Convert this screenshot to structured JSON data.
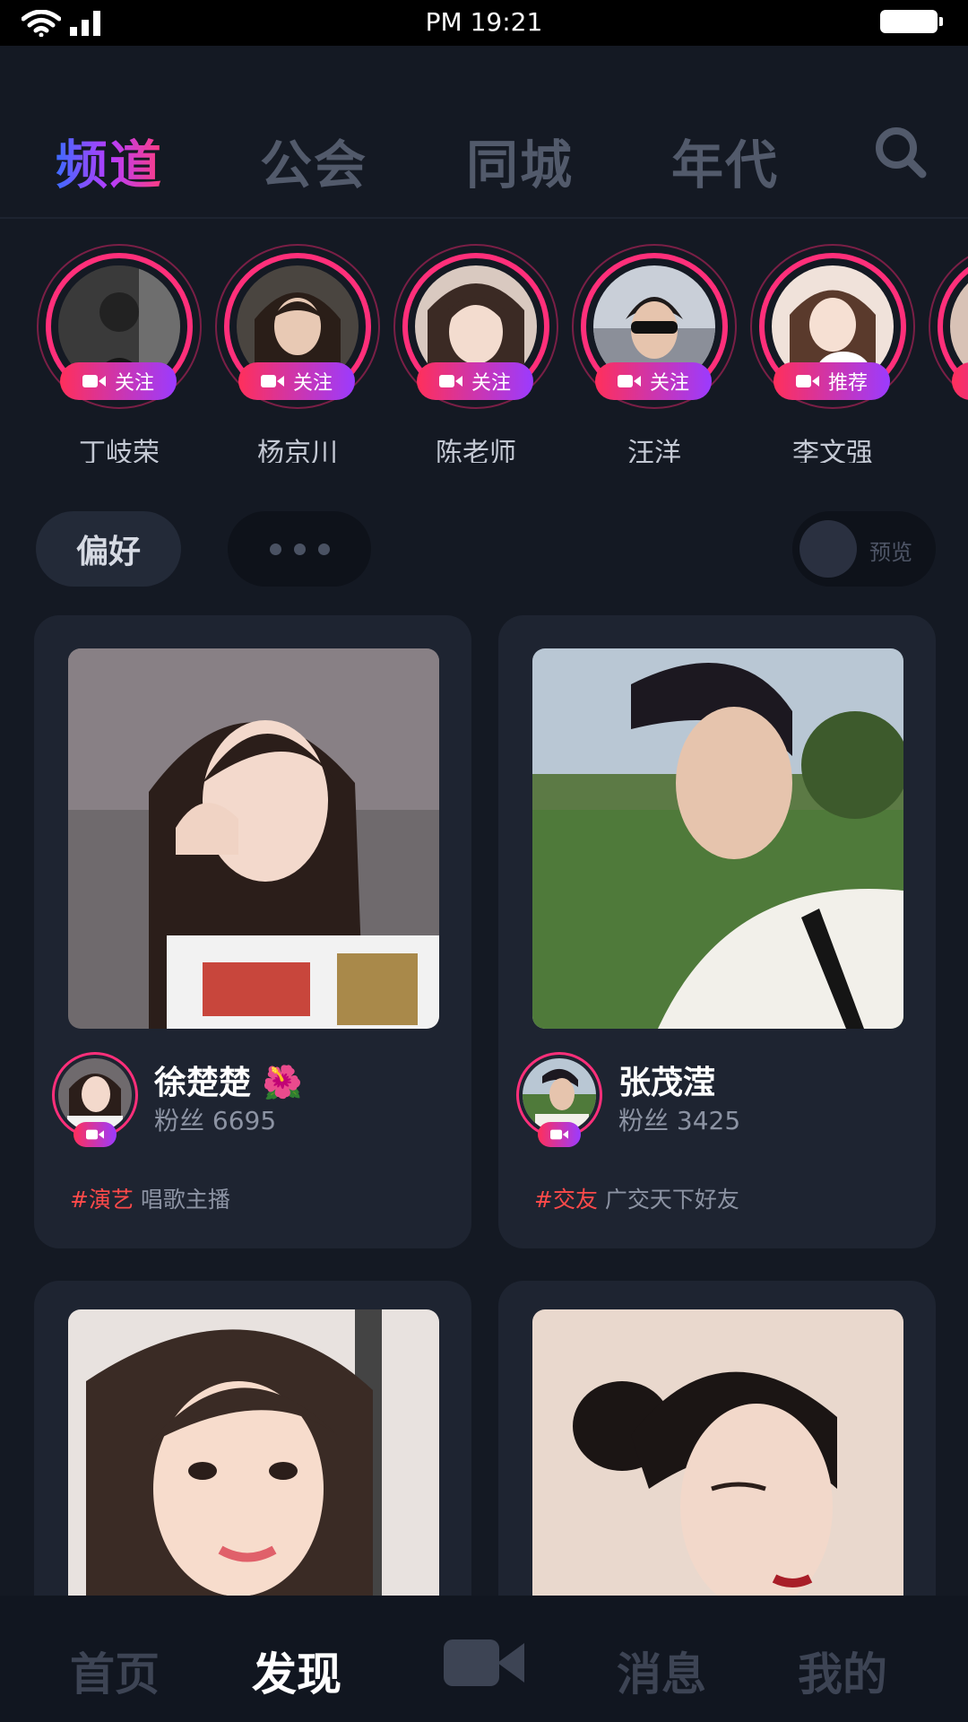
{
  "status_bar": {
    "time": "PM 19:21"
  },
  "top_tabs": [
    {
      "label": "频道",
      "active": true
    },
    {
      "label": "公会",
      "active": false
    },
    {
      "label": "同城",
      "active": false
    },
    {
      "label": "年代",
      "active": false
    }
  ],
  "search_icon": "search-icon",
  "stories": [
    {
      "name": "丁岐荣",
      "badge": "关注"
    },
    {
      "name": "杨京川",
      "badge": "关注"
    },
    {
      "name": "陈老师",
      "badge": "关注"
    },
    {
      "name": "汪洋",
      "badge": "关注"
    },
    {
      "name": "李文强",
      "badge": "推荐"
    }
  ],
  "filters": {
    "preference_label": "偏好",
    "more_icon": "more-dots-icon",
    "preview_label": "预览"
  },
  "cards": [
    {
      "name": "徐楚楚",
      "emoji": "🌺",
      "fans_label": "粉丝 6695",
      "tag": "#演艺",
      "description": "唱歌主播"
    },
    {
      "name": "张茂滢",
      "emoji": "",
      "fans_label": "粉丝 3425",
      "tag": "#交友",
      "description": "广交天下好友"
    },
    {
      "name": "",
      "emoji": "",
      "fans_label": "",
      "tag": "",
      "description": ""
    },
    {
      "name": "",
      "emoji": "",
      "fans_label": "",
      "tag": "",
      "description": ""
    }
  ],
  "bottom_nav": [
    {
      "label": "首页",
      "active": false
    },
    {
      "label": "发现",
      "active": true
    },
    {
      "label": "消息",
      "active": false
    },
    {
      "label": "我的",
      "active": false
    }
  ],
  "colors": {
    "background": "#141923",
    "card": "#1e2431",
    "accent_pink": "#ff2f7a",
    "accent_purple": "#9b3bff",
    "tag_red": "#ff4a4a"
  }
}
